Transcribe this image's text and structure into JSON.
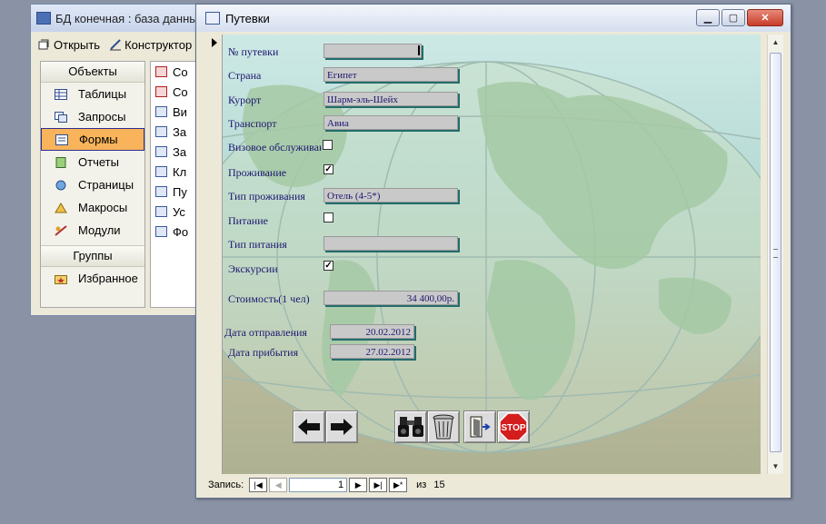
{
  "db_window": {
    "title": "БД конечная : база данных (",
    "toolbar": {
      "open": "Открыть",
      "designer": "Конструктор"
    },
    "objects_header": "Объекты",
    "objects": [
      "Таблицы",
      "Запросы",
      "Формы",
      "Отчеты",
      "Страницы",
      "Макросы",
      "Модули"
    ],
    "selected_object": "Формы",
    "groups_header": "Группы",
    "favorites": "Избранное",
    "list_items": [
      "Со",
      "Со",
      "Ви",
      "За",
      "За",
      "Кл",
      "Пу",
      "Ус",
      "Фо"
    ]
  },
  "form_window": {
    "title": "Путевки",
    "fields": {
      "voucher_no": {
        "label": "№ путевки",
        "value": ""
      },
      "country": {
        "label": "Страна",
        "value": "Египет"
      },
      "resort": {
        "label": "Курорт",
        "value": "Шарм-эль-Шейх"
      },
      "transport": {
        "label": "Транспорт",
        "value": "Авиа"
      },
      "visa": {
        "label": "Визовое обслуживание",
        "checked": false
      },
      "accommodation": {
        "label": "Проживание",
        "checked": true
      },
      "accommodation_type": {
        "label": "Тип проживания",
        "value": "Отель (4-5*)"
      },
      "meals": {
        "label": "Питание",
        "checked": false
      },
      "meal_type": {
        "label": "Тип питания",
        "value": ""
      },
      "excursions": {
        "label": "Экскурсии",
        "checked": true
      },
      "cost": {
        "label": "Стоимость(1 чел)",
        "value": "34 400,00р."
      },
      "departure": {
        "label": "Дата отправления",
        "value": "20.02.2012"
      },
      "arrival": {
        "label": "Дата прибытия",
        "value": "27.02.2012"
      }
    },
    "buttons": [
      "arrow-left-icon",
      "arrow-right-icon",
      "binoculars-icon",
      "trash-icon",
      "exit-door-icon",
      "stop-sign-icon"
    ],
    "stop_label": "STOP",
    "record_nav": {
      "label": "Запись:",
      "current": "1",
      "of_label": "из",
      "total": "15"
    }
  },
  "colors": {
    "label_text": "#1c1670",
    "field_shadow": "#246c6c",
    "selected_item": "#f9b45b",
    "stop_red": "#d41e1e"
  }
}
